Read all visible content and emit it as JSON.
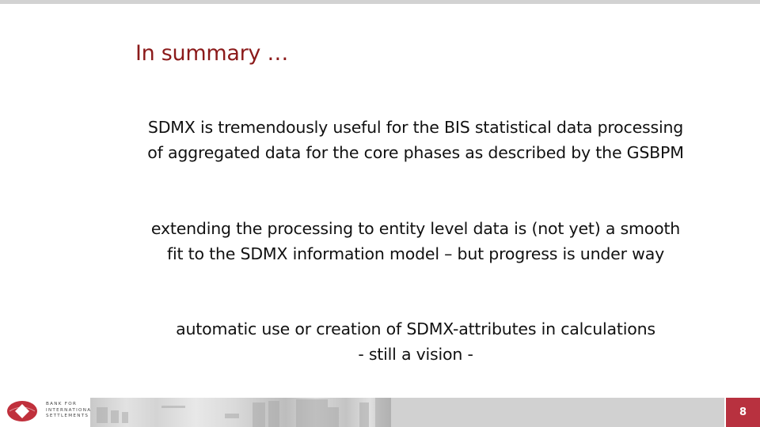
{
  "slide": {
    "title": "In summary …",
    "blocks": [
      {
        "lines": [
          "SDMX is tremendously useful for the BIS statistical data processing",
          "of aggregated data for the core phases as described by the GSBPM"
        ]
      },
      {
        "lines": [
          "extending the processing to entity level data is (not yet) a smooth",
          "fit to the SDMX information model – but  progress is under way"
        ]
      },
      {
        "lines": [
          "automatic use or creation of SDMX-attributes in calculations",
          "-  still a vision -"
        ]
      }
    ]
  },
  "footer": {
    "logo_icon": "bis-logo-icon",
    "logo_text": [
      "BANK FOR",
      "INTERNATIONAL",
      "SETTLEMENTS"
    ],
    "page_number": "8",
    "colors": {
      "accent": "#b8313f",
      "title": "#8b1a1a",
      "band": "#d1d1d1"
    }
  }
}
